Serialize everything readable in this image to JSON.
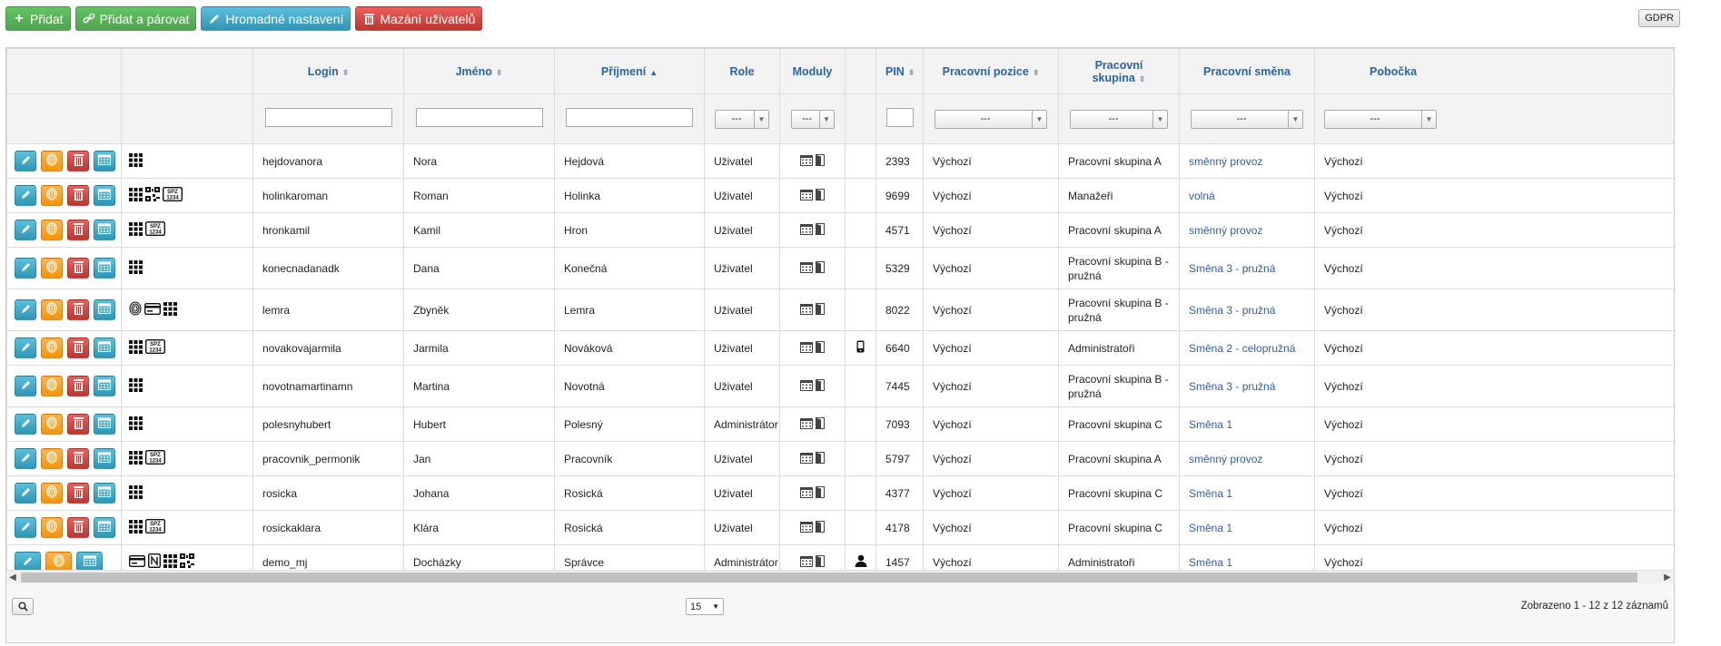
{
  "toolbar": {
    "add": "Přidat",
    "add_pair": "Přidat a párovat",
    "bulk": "Hromadné nastavení",
    "delete_users": "Mazání uživatelů",
    "gdpr": "GDPR"
  },
  "columns": {
    "login": "Login",
    "first": "Jméno",
    "last": "Příjmení",
    "role": "Role",
    "modules": "Moduly",
    "pin": "PIN",
    "position": "Pracovní pozice",
    "group": "Pracovní skupina",
    "shift": "Pracovní směna",
    "branch": "Pobočka"
  },
  "filters": {
    "select_placeholder": "---"
  },
  "colors": {
    "accent": "#2a64a8",
    "green": "#51a351",
    "blue": "#2f96b4",
    "red": "#bd362f",
    "orange": "#f89406"
  },
  "rows": [
    {
      "login": "hejdovanora",
      "first": "Nora",
      "last": "Hejdová",
      "role": "Uživatel",
      "pin": "2393",
      "position": "Výchozí",
      "group": "Pracovní skupina A",
      "shift": "směnný provoz",
      "branch": "Výchozí"
    },
    {
      "login": "holinkaroman",
      "first": "Roman",
      "last": "Holinka",
      "role": "Uživatel",
      "pin": "9699",
      "position": "Výchozí",
      "group": "Manažeři",
      "shift": "volná",
      "branch": "Výchozí"
    },
    {
      "login": "hronkamil",
      "first": "Kamil",
      "last": "Hron",
      "role": "Uživatel",
      "pin": "4571",
      "position": "Výchozí",
      "group": "Pracovní skupina A",
      "shift": "směnný provoz",
      "branch": "Výchozí"
    },
    {
      "login": "konecnadanadk",
      "first": "Dana",
      "last": "Konečná",
      "role": "Uživatel",
      "pin": "5329",
      "position": "Výchozí",
      "group": "Pracovní skupina B - pružná",
      "shift": "Směna 3 - pružná",
      "branch": "Výchozí"
    },
    {
      "login": "lemra",
      "first": "Zbyněk",
      "last": "Lemra",
      "role": "Uživatel",
      "pin": "8022",
      "position": "Výchozí",
      "group": "Pracovní skupina B - pružná",
      "shift": "Směna 3 - pružná",
      "branch": "Výchozí"
    },
    {
      "login": "novakovajarmila",
      "first": "Jarmila",
      "last": "Nováková",
      "role": "Uživatel",
      "pin": "6640",
      "position": "Výchozí",
      "group": "Administratoři",
      "shift": "Směna 2 - celopružná",
      "branch": "Výchozí"
    },
    {
      "login": "novotnamartinamn",
      "first": "Martina",
      "last": "Novotná",
      "role": "Uživatel",
      "pin": "7445",
      "position": "Výchozí",
      "group": "Pracovní skupina B - pružná",
      "shift": "Směna 3 - pružná",
      "branch": "Výchozí"
    },
    {
      "login": "polesnyhubert",
      "first": "Hubert",
      "last": "Polesný",
      "role": "Administrátor",
      "pin": "7093",
      "position": "Výchozí",
      "group": "Pracovní skupina C",
      "shift": "Směna 1",
      "branch": "Výchozí"
    },
    {
      "login": "pracovnik_permonik",
      "first": "Jan",
      "last": "Pracovník",
      "role": "Uživatel",
      "pin": "5797",
      "position": "Výchozí",
      "group": "Pracovní skupina A",
      "shift": "směnný provoz",
      "branch": "Výchozí"
    },
    {
      "login": "rosicka",
      "first": "Johana",
      "last": "Rosická",
      "role": "Uživatel",
      "pin": "4377",
      "position": "Výchozí",
      "group": "Pracovní skupina C",
      "shift": "Směna 1",
      "branch": "Výchozí"
    },
    {
      "login": "rosickaklara",
      "first": "Klára",
      "last": "Rosická",
      "role": "Uživatel",
      "pin": "4178",
      "position": "Výchozí",
      "group": "Pracovní skupina C",
      "shift": "Směna 1",
      "branch": "Výchozí"
    },
    {
      "login": "demo_mj",
      "first": "Docházky",
      "last": "Správce",
      "role": "Administrátor",
      "pin": "1457",
      "position": "Výchozí",
      "group": "Administratoři",
      "shift": "Směna 1",
      "branch": "Výchozí"
    }
  ],
  "footer": {
    "page_size": "15",
    "count": "Zobrazeno 1 - 12 z 12 záznamů"
  }
}
